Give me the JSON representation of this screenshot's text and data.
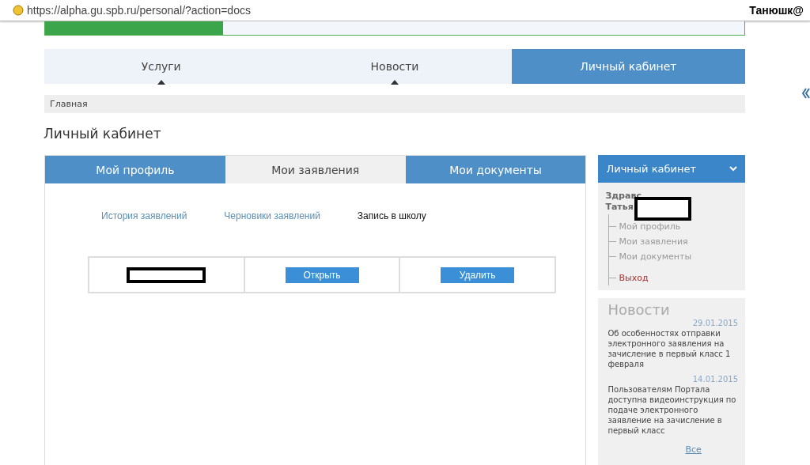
{
  "browser": {
    "url": "https://alpha.gu.spb.ru/personal/?action=docs",
    "user": "Танюшк@"
  },
  "nav": [
    {
      "label": "Услуги",
      "selected": false
    },
    {
      "label": "Новости",
      "selected": false
    },
    {
      "label": "Личный кабинет",
      "selected": true
    }
  ],
  "breadcrumb": "Главная",
  "page_title": "Личный кабинет",
  "profile_tabs": [
    {
      "label": "Мой профиль",
      "selected": false
    },
    {
      "label": "Мои заявления",
      "selected": true
    },
    {
      "label": "Мои документы",
      "selected": false
    }
  ],
  "sub_links": [
    {
      "label": "История заявлений",
      "selected": false
    },
    {
      "label": "Черновики заявлений",
      "selected": false
    },
    {
      "label": "Запись в школу",
      "selected": true
    }
  ],
  "applications": [
    {
      "open": "Открыть",
      "delete": "Удалить"
    }
  ],
  "sidebar": {
    "title": "Личный кабинет",
    "greeting": "Здравс",
    "name": "Татья",
    "items": [
      {
        "label": "Мой профиль",
        "kind": "link"
      },
      {
        "label": "Мои заявления",
        "kind": "link"
      },
      {
        "label": "Мои документы",
        "kind": "link"
      },
      {
        "label": "Выход",
        "kind": "exit"
      }
    ]
  },
  "news": {
    "title": "Новости",
    "items": [
      {
        "text": "Об особенностях отправки электронного заявления на зачисление в первый класс 1 февраля",
        "date": "29.01.2015"
      },
      {
        "text": "Пользователям Портала доступна видеоинструкция по подаче электронного заявление на зачисление в первый класс",
        "date": "14.01.2015"
      }
    ],
    "more": "Все"
  }
}
